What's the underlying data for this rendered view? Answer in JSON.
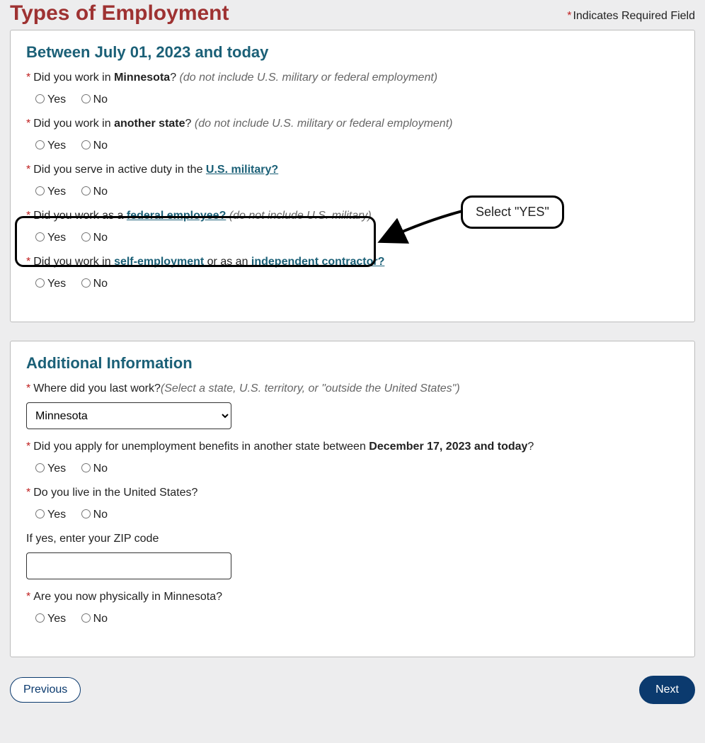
{
  "page_title": "Types of Employment",
  "required_note": "Indicates Required Field",
  "section1": {
    "title": "Between July 01, 2023 and today",
    "q1": {
      "pre": "Did you work in ",
      "bold": "Minnesota",
      "post": "? ",
      "hint": "(do not include U.S. military or federal employment)"
    },
    "q2": {
      "pre": "Did you work in ",
      "bold": "another state",
      "post": "? ",
      "hint": "(do not include U.S. military or federal employment)"
    },
    "q3": {
      "pre": "Did you serve in active duty in the ",
      "link": "U.S. military?"
    },
    "q4": {
      "pre": "Did you work as a ",
      "link": "federal employee?",
      "post": " ",
      "hint": "(do not include U.S. military)"
    },
    "q5": {
      "pre": "Did you work in ",
      "link1": "self-employment",
      "mid": " or as an ",
      "link2": "independent contractor?"
    }
  },
  "section2": {
    "title": "Additional Information",
    "q1": {
      "text": "Where did you last work?",
      "hint": "(Select a state, U.S. territory, or \"outside the United States\")",
      "selected": "Minnesota"
    },
    "q2": {
      "pre": "Did you apply for unemployment benefits in another state between ",
      "bold": "December 17, 2023 and today",
      "post": "?"
    },
    "q3": {
      "text": "Do you live in the United States?"
    },
    "q4": {
      "text": "If yes, enter your ZIP code",
      "value": ""
    },
    "q5": {
      "text": "Are you now physically in Minnesota?"
    }
  },
  "radios": {
    "yes": "Yes",
    "no": "No"
  },
  "callout": "Select \"YES\"",
  "buttons": {
    "prev": "Previous",
    "next": "Next"
  }
}
